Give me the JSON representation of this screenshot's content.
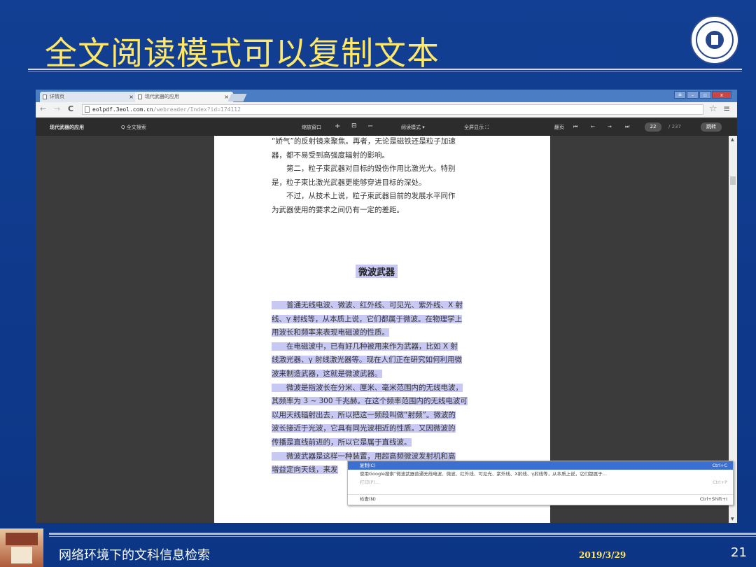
{
  "slide": {
    "title": "全文阅读模式可以复制文本",
    "footer_text": "网络环境下的文科信息检索",
    "date": "2019/3/29",
    "page_number": "21"
  },
  "browser": {
    "tabs": [
      {
        "label": "详情页"
      },
      {
        "label": "现代武器的应用"
      }
    ],
    "url_host": "eolpdf.3eol.com.cn",
    "url_path": "/webreader/Index?id=174112",
    "window_buttons": [
      "≗",
      "–",
      "▫",
      "x"
    ]
  },
  "toolbar": {
    "book_title": "现代武器的应用",
    "search_label": "Q  全文搜索",
    "zoom_label": "缩放窗口",
    "zoom_in": "+",
    "fit": "⊟",
    "zoom_out": "−",
    "read_mode": "阅读模式 ▾",
    "fullscreen": "全屏显示 ⛶",
    "turn_label": "翻页",
    "first": "⏮",
    "prev": "←",
    "next": "→",
    "last": "⏭",
    "current_page": "22",
    "total_pages": "/ 237",
    "jump": "跳转"
  },
  "document": {
    "top_lines": [
      "“娇气”的反射镜来聚焦。再者，无论是磁铁还是粒子加速",
      "器，都不易受到高强度辐射的影响。",
      "　　第二，粒子束武器对目标的毁伤作用比激光大。特别",
      "是，粒子束比激光武器更能够穿进目标的深处。",
      "　　不过，从技术上说，粒子束武器目前的发展水平同作",
      "为武器使用的要求之间仍有一定的差距。"
    ],
    "heading": "微波武器",
    "selected_lines": [
      "　　普通无线电波、微波、红外线、可见光、紫外线、X 射",
      "线、γ 射线等，从本质上说，它们都属于微波。在物理学上",
      "用波长和频率来表现电磁波的性质。",
      "　　在电磁波中，已有好几种被用来作为武器，比如 X 射",
      "线激光器、γ 射线激光器等。现在人们正在研究如何利用微",
      "波来制造武器，这就是微波武器。",
      "　　微波是指波长在分米、厘米、毫米范围内的无线电波，",
      "其频率为 3 ~ 300 千兆赫。在这个频率范围内的无线电波可",
      "以用天线辐射出去，所以把这一频段叫做“射频”。微波的",
      "波长接近于光波，它具有同光波相近的性质。又因微波的",
      "传播是直线前进的，所以它是属于直线波。",
      "　　微波武器是这样一种装置，用超高频微波发射机和高",
      "增益定向天线，来发"
    ]
  },
  "context_menu": {
    "items": [
      {
        "label": "复制(C)",
        "shortcut": "Ctrl+C"
      },
      {
        "label": "使用Google搜索“微波武器普通无线电波、微波、红外线、可见光、紫外线、X射线、γ射线等，从本质上说，它们都属于…",
        "shortcut": ""
      },
      {
        "label": "打印(P)...",
        "shortcut": "Ctrl+P"
      },
      {
        "label": "检查(N)",
        "shortcut": "Ctrl+Shift+I"
      }
    ]
  }
}
